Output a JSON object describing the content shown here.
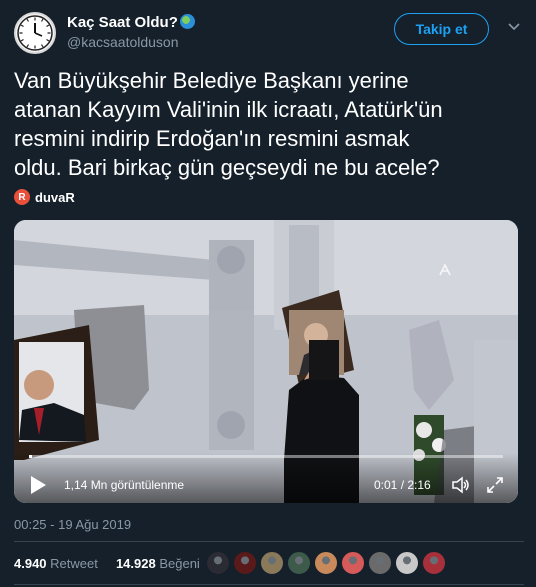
{
  "user": {
    "display_name": "Kaç Saat Oldu?",
    "handle": "@kacsaatolduson",
    "follow_label": "Takip et"
  },
  "tweet": {
    "text": "Van Büyükşehir Belediye Başkanı yerine\natanan Kayyım Vali'inin ilk icraatı, Atatürk'ün\nresmini indirip Erdoğan'ın resmini asmak\noldu. Bari birkaç gün geçseydi ne bu acele?",
    "source_logo": "R",
    "source_name": "duvaR",
    "timestamp": "00:25 - 19 Ağu 2019"
  },
  "video": {
    "views": "1,14 Mn görüntülenme",
    "time": "0:01 / 2:16",
    "progress": 0.007,
    "watermark_icon": "aa-logo-icon"
  },
  "stats": {
    "retweets_count": "4.940",
    "retweets_label": "Retweet",
    "likes_count": "14.928",
    "likes_label": "Beğeni"
  },
  "likers": [
    "#2b2b33",
    "#5a1a1a",
    "#8a7a5a",
    "#3d5a4a",
    "#c88a5a",
    "#d65a5a",
    "#6a6a6a",
    "#c8c8c8",
    "#a8303a"
  ],
  "colors": {
    "background": "#15202b",
    "accent": "#1da1f2",
    "muted": "#8899a6"
  }
}
